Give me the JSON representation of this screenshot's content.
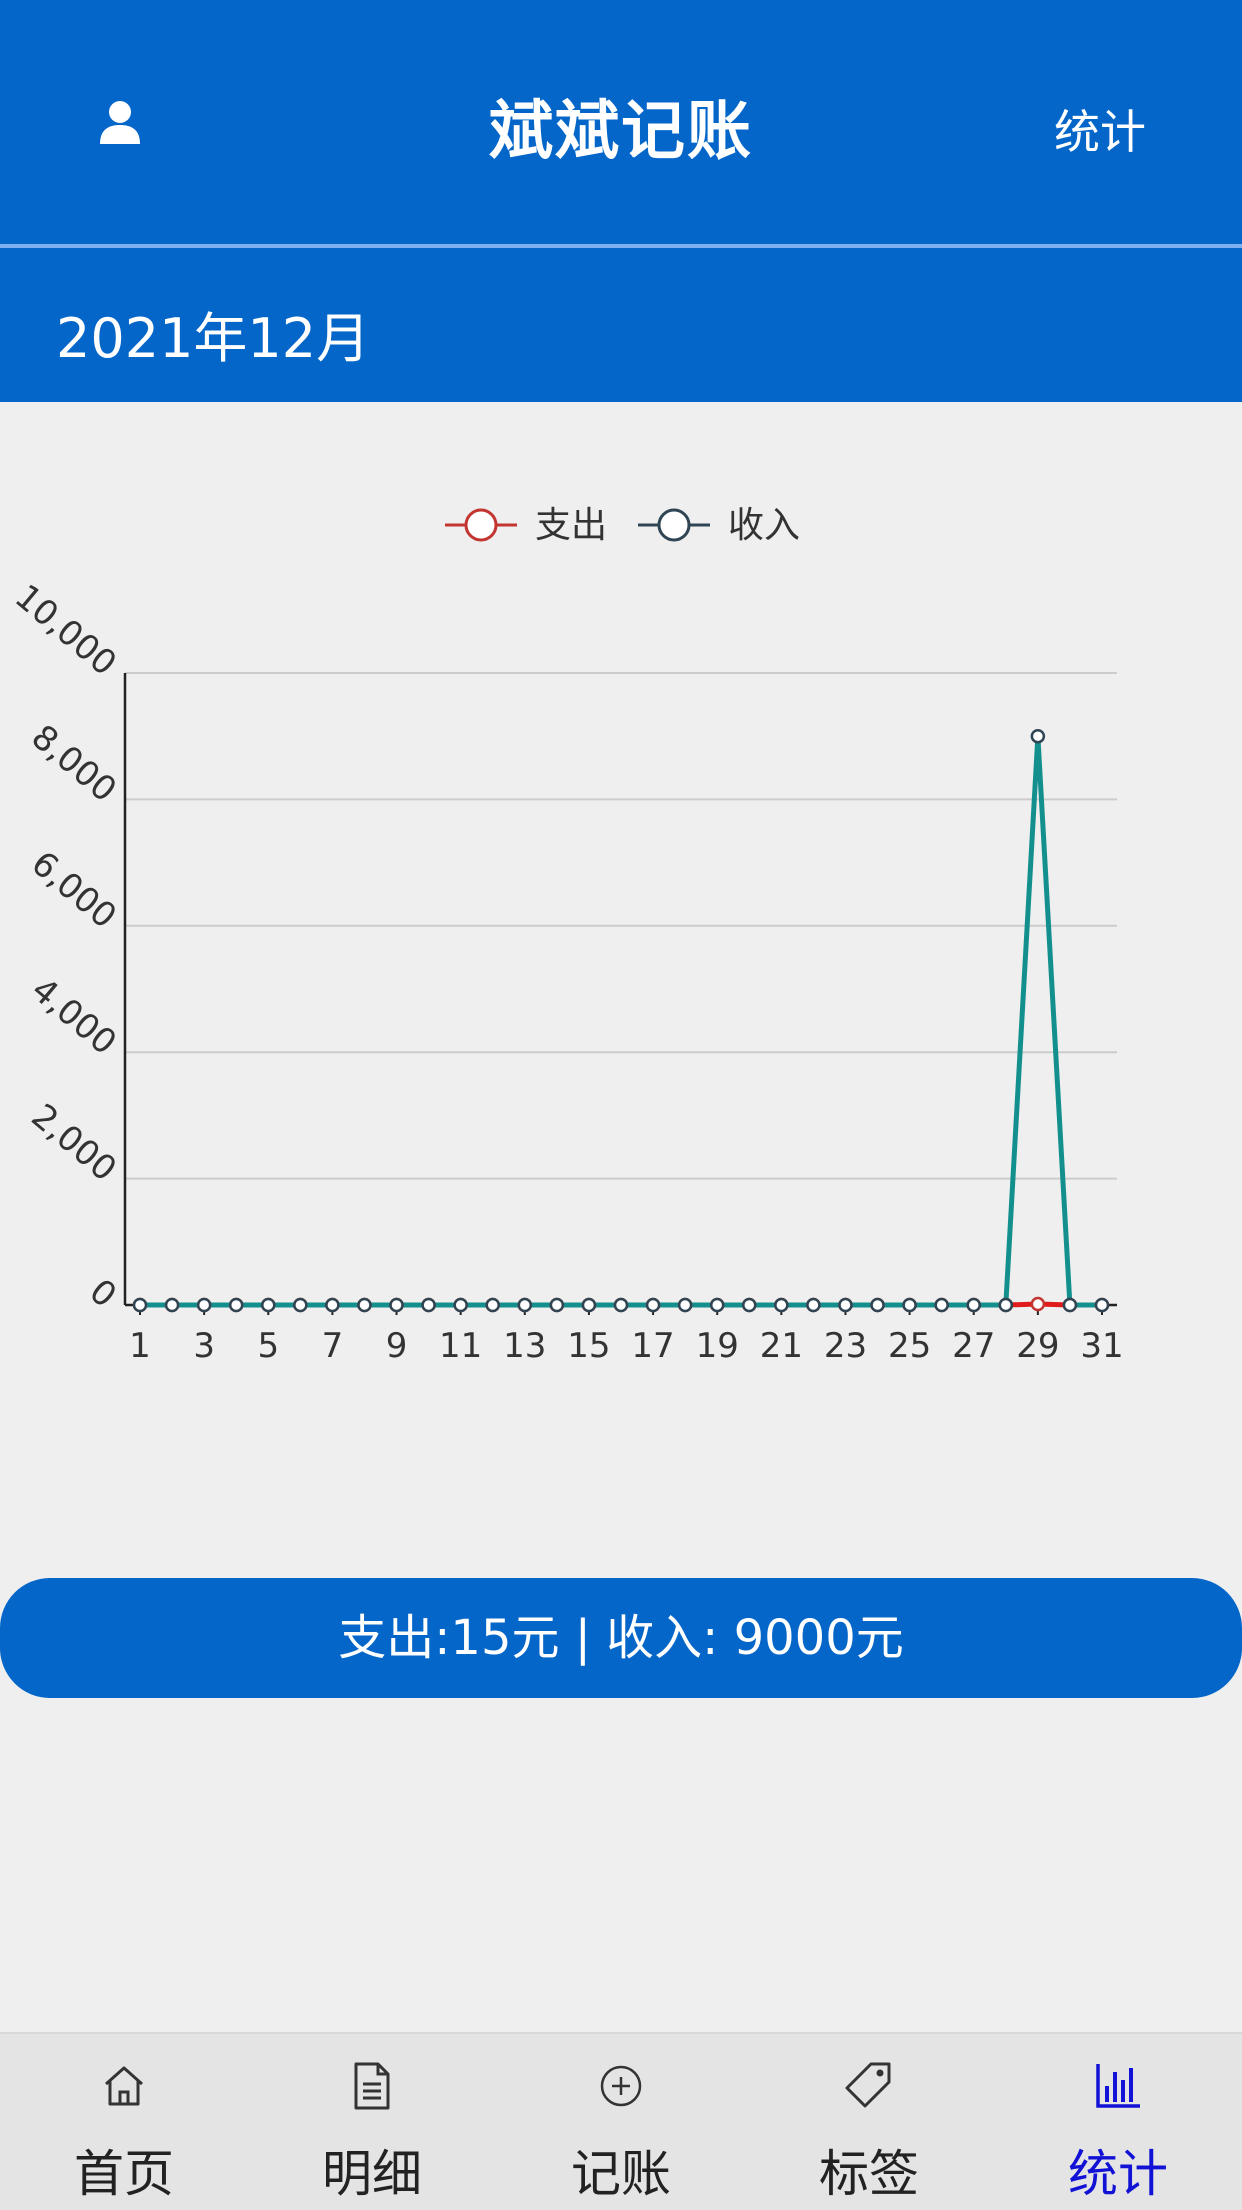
{
  "header": {
    "title": "斌斌记账",
    "right_link": "统计",
    "user_icon": "user-icon"
  },
  "month": "2021年12月",
  "chart_data": {
    "type": "line",
    "legend": [
      {
        "name": "支出",
        "color": "#c23531"
      },
      {
        "name": "收入",
        "color": "#2f4554"
      }
    ],
    "x": [
      1,
      2,
      3,
      4,
      5,
      6,
      7,
      8,
      9,
      10,
      11,
      12,
      13,
      14,
      15,
      16,
      17,
      18,
      19,
      20,
      21,
      22,
      23,
      24,
      25,
      26,
      27,
      28,
      29,
      30,
      31
    ],
    "x_tick_labels": [
      "1",
      "3",
      "5",
      "7",
      "9",
      "11",
      "13",
      "15",
      "17",
      "19",
      "21",
      "23",
      "25",
      "27",
      "29",
      "31"
    ],
    "y_tick_labels": [
      "0",
      "2,000",
      "4,000",
      "6,000",
      "8,000",
      "10,000"
    ],
    "ylim": [
      0,
      10000
    ],
    "series": [
      {
        "name": "支出",
        "line_color": "#e01b1b",
        "values": [
          0,
          0,
          0,
          0,
          0,
          0,
          0,
          0,
          0,
          0,
          0,
          0,
          0,
          0,
          0,
          0,
          0,
          0,
          0,
          0,
          0,
          0,
          0,
          0,
          0,
          0,
          0,
          0,
          15,
          0,
          0
        ]
      },
      {
        "name": "收入",
        "line_color": "#13908e",
        "values": [
          0,
          0,
          0,
          0,
          0,
          0,
          0,
          0,
          0,
          0,
          0,
          0,
          0,
          0,
          0,
          0,
          0,
          0,
          0,
          0,
          0,
          0,
          0,
          0,
          0,
          0,
          0,
          0,
          9000,
          0,
          0
        ]
      }
    ],
    "grid": true
  },
  "summary": "支出:15元 | 收入: 9000元",
  "tabs": [
    {
      "label": "首页",
      "icon": "home-icon",
      "active": false
    },
    {
      "label": "明细",
      "icon": "document-icon",
      "active": false
    },
    {
      "label": "记账",
      "icon": "plus-circle-icon",
      "active": false
    },
    {
      "label": "标签",
      "icon": "tag-icon",
      "active": false
    },
    {
      "label": "统计",
      "icon": "bar-chart-icon",
      "active": true
    }
  ]
}
